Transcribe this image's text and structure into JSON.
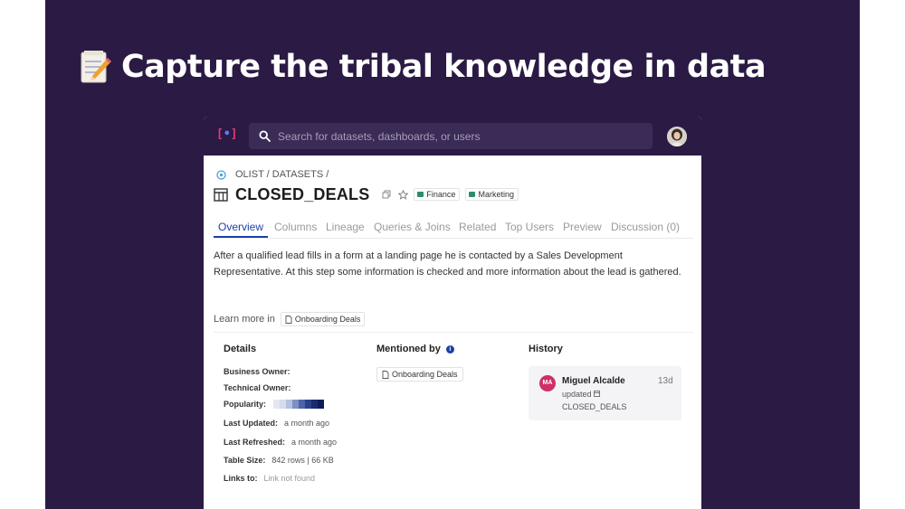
{
  "headline": {
    "text": "Capture the tribal knowledge in data",
    "emoji_icon": "memo-icon"
  },
  "app": {
    "logo": {
      "open": "[",
      "dot": "•",
      "close": "]"
    },
    "search": {
      "placeholder": "Search for datasets, dashboards, or users",
      "icon": "search-icon"
    },
    "breadcrumb": "OLIST / DATASETS /",
    "dataset": {
      "title": "CLOSED_DEALS",
      "tags": [
        "Finance",
        "Marketing"
      ]
    },
    "tabs": [
      {
        "label": "Overview",
        "active": true
      },
      {
        "label": "Columns"
      },
      {
        "label": "Lineage"
      },
      {
        "label": "Queries & Joins"
      },
      {
        "label": "Related"
      },
      {
        "label": "Top Users"
      },
      {
        "label": "Preview"
      },
      {
        "label": "Discussion (0)"
      }
    ],
    "description": "After a qualified lead fills in a form at a landing page he is contacted by a Sales Development Representative. At this step some information is checked and more information about the lead is gathered.",
    "learn_more": {
      "label": "Learn more in",
      "doc": "Onboarding Deals"
    },
    "details": {
      "heading": "Details",
      "business_owner": "Business Owner:",
      "technical_owner": "Technical Owner:",
      "popularity_label": "Popularity:",
      "popularity_level": 0.6,
      "last_updated_label": "Last Updated:",
      "last_updated": "a month ago",
      "last_refreshed_label": "Last Refreshed:",
      "last_refreshed": "a month ago",
      "table_size_label": "Table Size:",
      "table_size": "842 rows | 66 KB",
      "links_label": "Links to:",
      "links": "Link not found"
    },
    "mentioned_by": {
      "heading": "Mentioned by",
      "doc": "Onboarding Deals"
    },
    "history": {
      "heading": "History",
      "initials": "MA",
      "user": "Miguel Alcalde",
      "action": "updated",
      "target": "CLOSED_DEALS",
      "time": "13d"
    }
  },
  "colors": {
    "background": "#2a1a44",
    "accent": "#1e3fa8",
    "avatar_history": "#d12f66",
    "tag_green": "#2d8c6b"
  }
}
